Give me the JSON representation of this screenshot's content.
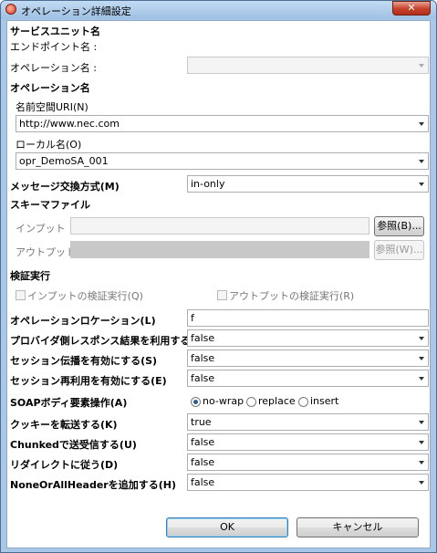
{
  "window": {
    "title": "オペレーション詳細設定",
    "close_label": "✕"
  },
  "service_unit": {
    "heading": "サービスユニット名",
    "endpoint_label": "エンドポイント名 :",
    "operation_label": "オペレーション名 :",
    "operation_value": ""
  },
  "operation_name": {
    "heading": "オペレーション名",
    "namespace_label": "名前空間URI(N)",
    "namespace_value": "http://www.nec.com",
    "local_label": "ローカル名(O)",
    "local_value": "opr_DemoSA_001"
  },
  "message_exchange": {
    "label": "メッセージ交換方式(M)",
    "value": "in-only"
  },
  "schema": {
    "heading": "スキーマファイル",
    "input_label": "インプット",
    "input_value": "",
    "input_browse": "参照(B)...",
    "output_label": "アウトプット",
    "output_value": "",
    "output_browse": "参照(W)..."
  },
  "validation": {
    "heading": "検証実行",
    "input_check": "インプットの検証実行(Q)",
    "output_check": "アウトプットの検証実行(R)"
  },
  "settings": {
    "location_label": "オペレーションロケーション(L)",
    "location_value": "f",
    "provider_label": "プロバイダ側レスポンス結果を利用する(P)",
    "provider_value": "false",
    "session_prop_label": "セッション伝播を有効にする(S)",
    "session_prop_value": "false",
    "session_reuse_label": "セッション再利用を有効にする(E)",
    "session_reuse_value": "false",
    "soap_label": "SOAPボディ要素操作(A)",
    "soap_options": [
      "no-wrap",
      "replace",
      "insert"
    ],
    "soap_selected": "no-wrap",
    "cookie_label": "クッキーを転送する(K)",
    "cookie_value": "true",
    "chunked_label": "Chunkedで送受信する(U)",
    "chunked_value": "false",
    "redirect_label": "リダイレクトに従う(D)",
    "redirect_value": "false",
    "header_label": "NoneOrAllHeaderを追加する(H)",
    "header_value": "false"
  },
  "footer": {
    "ok_label": "OK",
    "cancel_label": "キャンセル"
  }
}
